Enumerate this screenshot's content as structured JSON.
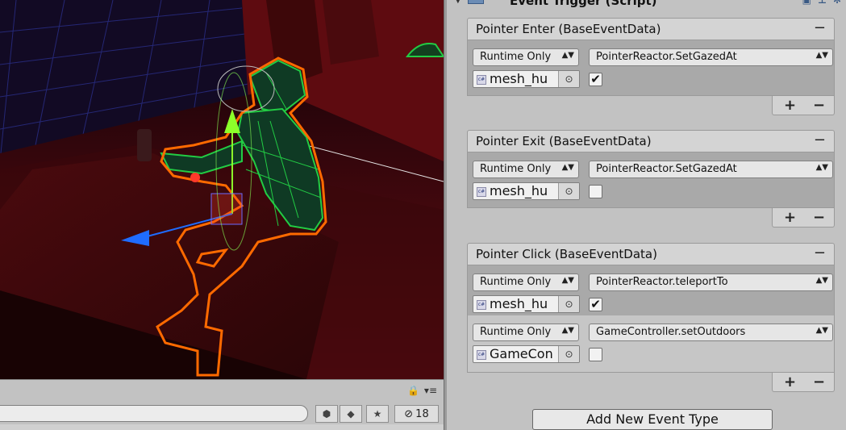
{
  "inspector": {
    "component_title": "Event Trigger (Script)",
    "add_button_label": "Add New Event Type",
    "events": [
      {
        "label": "Pointer Enter (BaseEventData)",
        "entries": [
          {
            "mode": "Runtime Only",
            "function": "PointerReactor.SetGazedAt",
            "object": "mesh_hu",
            "checked": true
          }
        ]
      },
      {
        "label": "Pointer Exit (BaseEventData)",
        "entries": [
          {
            "mode": "Runtime Only",
            "function": "PointerReactor.SetGazedAt",
            "object": "mesh_hu",
            "checked": false
          }
        ]
      },
      {
        "label": "Pointer Click (BaseEventData)",
        "entries": [
          {
            "mode": "Runtime Only",
            "function": "PointerReactor.teleportTo",
            "object": "mesh_hu",
            "checked": true
          },
          {
            "mode": "Runtime Only",
            "function": "GameController.setOutdoors",
            "object": "GameCon",
            "checked": false
          }
        ]
      }
    ],
    "plus_symbol": "+",
    "minus_symbol": "−",
    "pick_symbol": "⊙",
    "check_symbol": "✔"
  },
  "scene_toolbar": {
    "hidden_count": "18",
    "lock_icon": "lock-icon",
    "menu_icon": "menu-icon"
  },
  "colors": {
    "selection_outline": "#ff6a00",
    "wireframe": "#22cc44",
    "gizmo_y": "#8cff2a",
    "gizmo_x": "#1f6cff"
  }
}
